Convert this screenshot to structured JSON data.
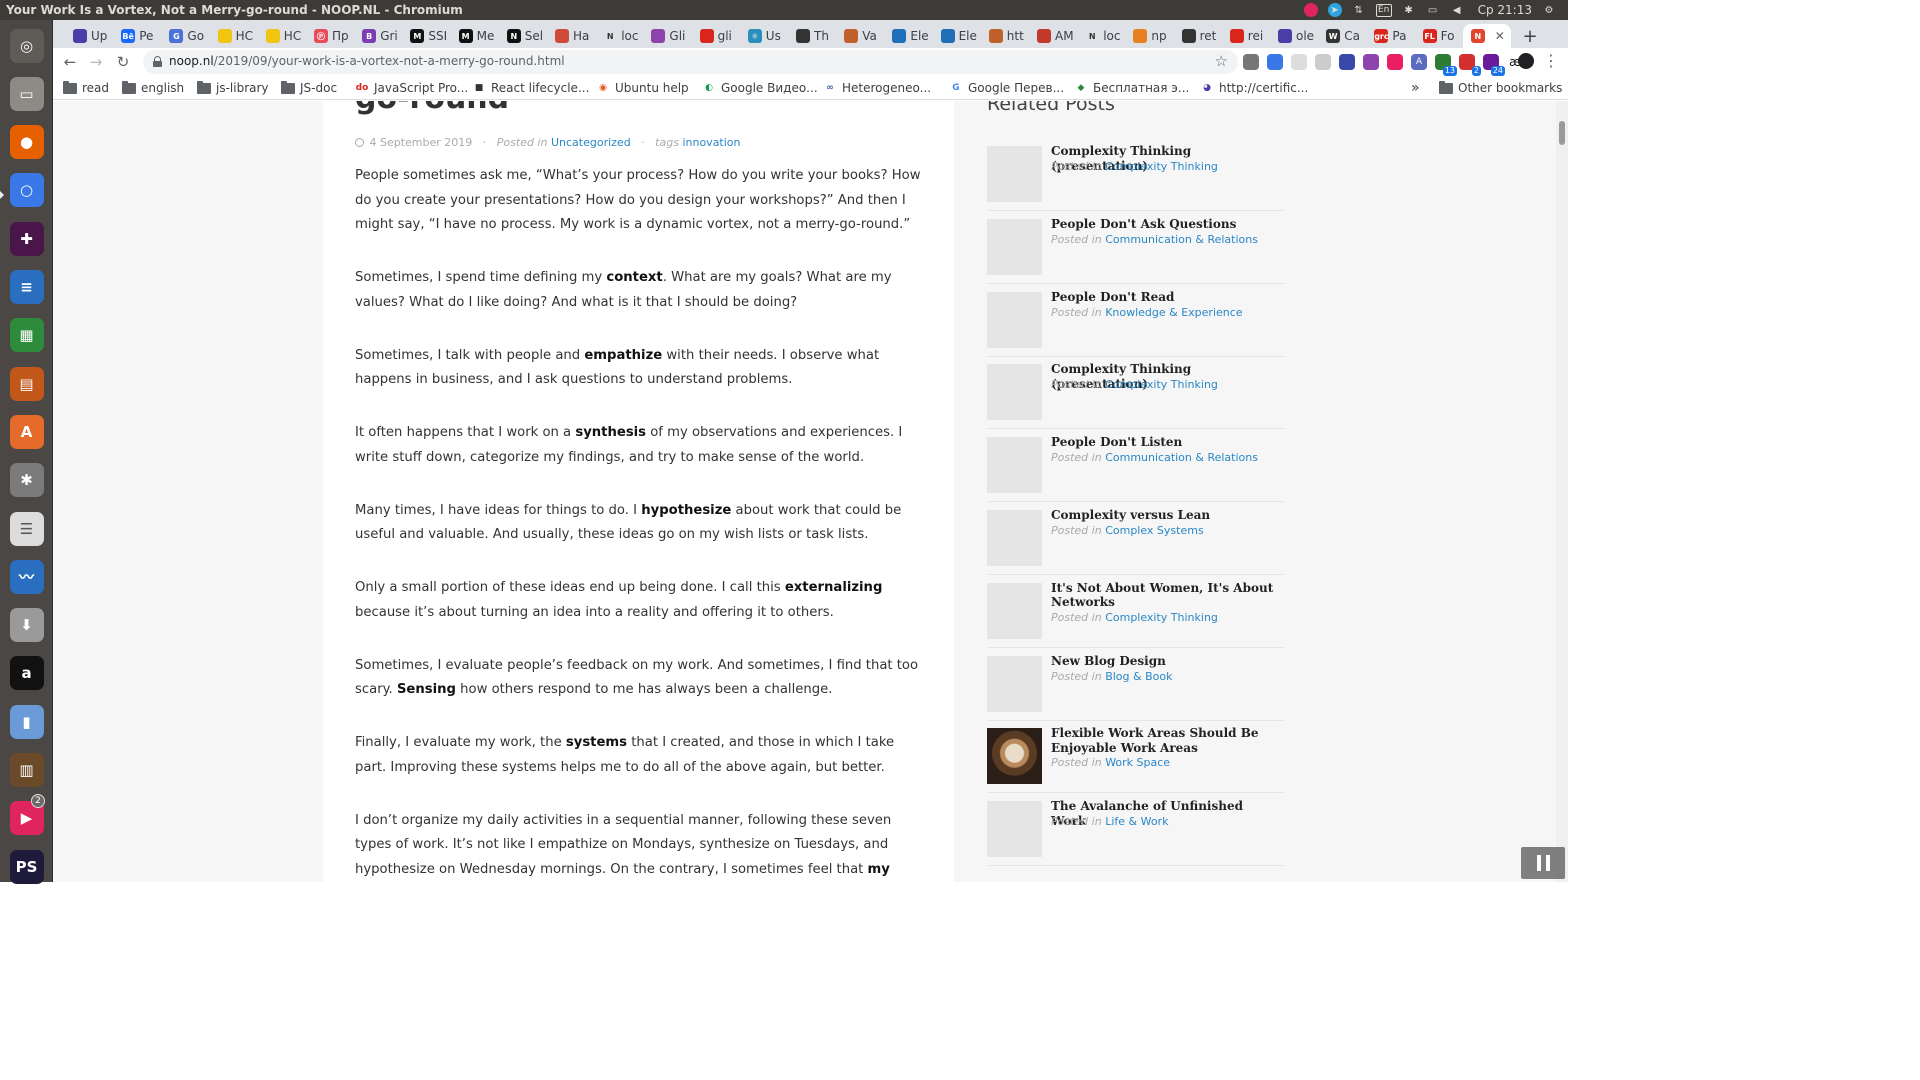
{
  "window": {
    "title": "Your Work Is a Vortex, Not a Merry-go-round - NOOP.NL - Chromium",
    "clock": "Ср 21:13",
    "lang_indicator": "En"
  },
  "launcher": {
    "items": [
      {
        "name": "ubuntu-dash-icon",
        "glyph": "◎",
        "color": "#5f5c58"
      },
      {
        "name": "files-icon",
        "glyph": "▭",
        "color": "#8e8b86"
      },
      {
        "name": "firefox-icon",
        "glyph": "●",
        "color": "#e66000"
      },
      {
        "name": "chromium-icon",
        "glyph": "○",
        "color": "#3b78e7"
      },
      {
        "name": "slack-icon",
        "glyph": "✚",
        "color": "#4a154b"
      },
      {
        "name": "writer-icon",
        "glyph": "≡",
        "color": "#2a6fbf"
      },
      {
        "name": "calc-icon",
        "glyph": "▦",
        "color": "#2e8b3c"
      },
      {
        "name": "impress-icon",
        "glyph": "▤",
        "color": "#c2571a"
      },
      {
        "name": "software-center-icon",
        "glyph": "A",
        "color": "#e46b2a"
      },
      {
        "name": "settings-icon",
        "glyph": "✱",
        "color": "#7b7b7b"
      },
      {
        "name": "text-editor-icon",
        "glyph": "☰",
        "color": "#dcdcdc"
      },
      {
        "name": "system-monitor-icon",
        "glyph": "〰",
        "color": "#2a6fbf"
      },
      {
        "name": "install-icon",
        "glyph": "⬇",
        "color": "#9a9a9a"
      },
      {
        "name": "amazon-icon",
        "glyph": "a",
        "color": "#111111"
      },
      {
        "name": "ruler-icon",
        "glyph": "▮",
        "color": "#6a9bd8"
      },
      {
        "name": "library-icon",
        "glyph": "▥",
        "color": "#6b4a2a"
      },
      {
        "name": "jetbrains-icon",
        "glyph": "▶",
        "color": "#e0245e",
        "badge": "2"
      },
      {
        "name": "phpstorm-icon",
        "glyph": "PS",
        "color": "#1d1a3a"
      }
    ]
  },
  "tabs": [
    {
      "label": "Up",
      "fav_color": "#4b3ca7",
      "fav_text": ""
    },
    {
      "label": "Pe",
      "fav_color": "#1769ff",
      "fav_text": "Bē"
    },
    {
      "label": "Go",
      "fav_color": "#4a72d8",
      "fav_text": "G"
    },
    {
      "label": "HC",
      "fav_color": "#f1c40f",
      "fav_text": ""
    },
    {
      "label": "HC",
      "fav_color": "#f1c40f",
      "fav_text": ""
    },
    {
      "label": "Пр",
      "fav_color": "#e84b5a",
      "fav_text": "Ⓟ"
    },
    {
      "label": "Gri",
      "fav_color": "#7b3fb5",
      "fav_text": "B"
    },
    {
      "label": "SSI",
      "fav_color": "#111111",
      "fav_text": "M"
    },
    {
      "label": "Me",
      "fav_color": "#111111",
      "fav_text": "M"
    },
    {
      "label": "Sel",
      "fav_color": "#111111",
      "fav_text": "N"
    },
    {
      "label": "Ha",
      "fav_color": "#d04a3a",
      "fav_text": ""
    },
    {
      "label": "loc",
      "fav_color": "#dee1e6",
      "fav_text": "N"
    },
    {
      "label": "Gli",
      "fav_color": "#8e44ad",
      "fav_text": ""
    },
    {
      "label": "gli",
      "fav_color": "#d9261c",
      "fav_text": ""
    },
    {
      "label": "Us",
      "fav_color": "#2c8ebb",
      "fav_text": "⚛"
    },
    {
      "label": "Th",
      "fav_color": "#333333",
      "fav_text": ""
    },
    {
      "label": "Va",
      "fav_color": "#c0612b",
      "fav_text": ""
    },
    {
      "label": "Ele",
      "fav_color": "#1f6fb8",
      "fav_text": ""
    },
    {
      "label": "Ele",
      "fav_color": "#1f6fb8",
      "fav_text": ""
    },
    {
      "label": "htt",
      "fav_color": "#c0612b",
      "fav_text": ""
    },
    {
      "label": "AM",
      "fav_color": "#c0392b",
      "fav_text": ""
    },
    {
      "label": "loc",
      "fav_color": "#dee1e6",
      "fav_text": "N"
    },
    {
      "label": "np",
      "fav_color": "#e67e22",
      "fav_text": ""
    },
    {
      "label": "ret",
      "fav_color": "#333333",
      "fav_text": ""
    },
    {
      "label": "rei",
      "fav_color": "#d9261c",
      "fav_text": ""
    },
    {
      "label": "ole",
      "fav_color": "#4b3ca7",
      "fav_text": ""
    },
    {
      "label": "Ca",
      "fav_color": "#333333",
      "fav_text": "W"
    },
    {
      "label": "Pa",
      "fav_color": "#d9261c",
      "fav_text": "grc"
    },
    {
      "label": "Fo",
      "fav_color": "#d9261c",
      "fav_text": "FL"
    },
    {
      "label": "",
      "fav_color": "#e2452d",
      "fav_text": "N",
      "active": true
    }
  ],
  "toolbar": {
    "url_host": "noop.nl",
    "url_path": "/2019/09/your-work-is-a-vortex-not-a-merry-go-round.html",
    "extension_badges": [
      "13",
      "2",
      "24"
    ]
  },
  "bookmarks": {
    "items": [
      {
        "label": "read",
        "type": "folder"
      },
      {
        "label": "english",
        "type": "folder"
      },
      {
        "label": "js-library",
        "type": "folder"
      },
      {
        "label": "JS-doc",
        "type": "folder"
      },
      {
        "label": "JavaScript Pro...",
        "type": "link",
        "fav_text": "do",
        "fav_color": "#d9261c"
      },
      {
        "label": "React lifecycle...",
        "type": "link",
        "fav_text": "■",
        "fav_color": "#333333"
      },
      {
        "label": "Ubuntu help",
        "type": "link",
        "fav_text": "◉",
        "fav_color": "#e95420"
      },
      {
        "label": "Google Видео...",
        "type": "link",
        "fav_text": "◐",
        "fav_color": "#0f9d58"
      },
      {
        "label": "Heterogeneo...",
        "type": "link",
        "fav_text": "∞",
        "fav_color": "#3b5ba7"
      },
      {
        "label": "Google Перев...",
        "type": "link",
        "fav_text": "G",
        "fav_color": "#4285f4"
      },
      {
        "label": "Бесплатная э...",
        "type": "link",
        "fav_text": "◆",
        "fav_color": "#2e8b3c"
      },
      {
        "label": "http://certific...",
        "type": "link",
        "fav_text": "◕",
        "fav_color": "#4b3ca7"
      }
    ],
    "overflow": "»",
    "other": "Other bookmarks"
  },
  "article": {
    "title_tail": "go-round",
    "date": "4 September 2019",
    "posted_in_label": "Posted in",
    "category": "Uncategorized",
    "tags_label": "tags",
    "tag": "innovation",
    "paragraphs": [
      [
        {
          "t": "People sometimes ask me, “What’s your process? How do you write your books? How do you create your presentations? How do you design your workshops?” And then I might say, “I have no process. My work is a dynamic vortex, not a merry-go-round.”"
        }
      ],
      [
        {
          "t": "Sometimes, I spend time defining my "
        },
        {
          "t": "context",
          "b": true
        },
        {
          "t": ". What are my goals? What are my values? What do I like doing? And what is it that I should be doing?"
        }
      ],
      [
        {
          "t": "Sometimes, I talk with people and "
        },
        {
          "t": "empathize",
          "b": true
        },
        {
          "t": " with their needs. I observe what happens in business, and I ask questions to understand problems."
        }
      ],
      [
        {
          "t": "It often happens that I work on a "
        },
        {
          "t": "synthesis",
          "b": true
        },
        {
          "t": " of my observations and experiences. I write stuff down, categorize my findings, and try to make sense of the world."
        }
      ],
      [
        {
          "t": "Many times, I have ideas for things to do. I "
        },
        {
          "t": "hypothesize",
          "b": true
        },
        {
          "t": " about work that could be useful and valuable. And usually, these ideas go on my wish lists or task lists."
        }
      ],
      [
        {
          "t": "Only a small portion of these ideas end up being done. I call this "
        },
        {
          "t": "externalizing",
          "b": true
        },
        {
          "t": " because it’s about turning an idea into a reality and offering it to others."
        }
      ],
      [
        {
          "t": "Sometimes, I evaluate people’s feedback on my work. And sometimes, I find that too scary. "
        },
        {
          "t": "Sensing",
          "b": true
        },
        {
          "t": " how others respond to me has always been a challenge."
        }
      ],
      [
        {
          "t": "Finally, I evaluate my work, the "
        },
        {
          "t": "systems",
          "b": true
        },
        {
          "t": " that I created, and those in which I take part. Improving these systems helps me to do all of the above again, but better."
        }
      ],
      [
        {
          "t": "I don’t organize my daily activities in a sequential manner, following these seven types of work. It’s not like I empathize on Mondays, synthesize on Tuesdays, and hypothesize on Wednesday mornings. On the contrary, I sometimes feel that "
        },
        {
          "t": "my work-life is a creative and",
          "b": true
        }
      ]
    ]
  },
  "sidebar": {
    "heading": "Related Posts",
    "posted_in_label": "Posted in",
    "posts": [
      {
        "title": "Complexity Thinking (presentation)",
        "category": "Complexity Thinking"
      },
      {
        "title": "People Don't Ask Questions",
        "category": "Communication & Relations"
      },
      {
        "title": "People Don't Read",
        "category": "Knowledge & Experience"
      },
      {
        "title": "Complexity Thinking (presentation)",
        "category": "Complexity Thinking"
      },
      {
        "title": "People Don't Listen",
        "category": "Communication & Relations"
      },
      {
        "title": "Complexity versus Lean",
        "category": "Complex Systems"
      },
      {
        "title": "It's Not About Women, It's About Networks",
        "category": "Complexity Thinking"
      },
      {
        "title": "New Blog Design",
        "category": "Blog & Book"
      },
      {
        "title": "Flexible Work Areas Should Be Enjoyable Work Areas",
        "category": "Work Space",
        "photo": true
      },
      {
        "title": "The Avalanche of Unfinished Work",
        "category": "Life & Work"
      }
    ]
  }
}
